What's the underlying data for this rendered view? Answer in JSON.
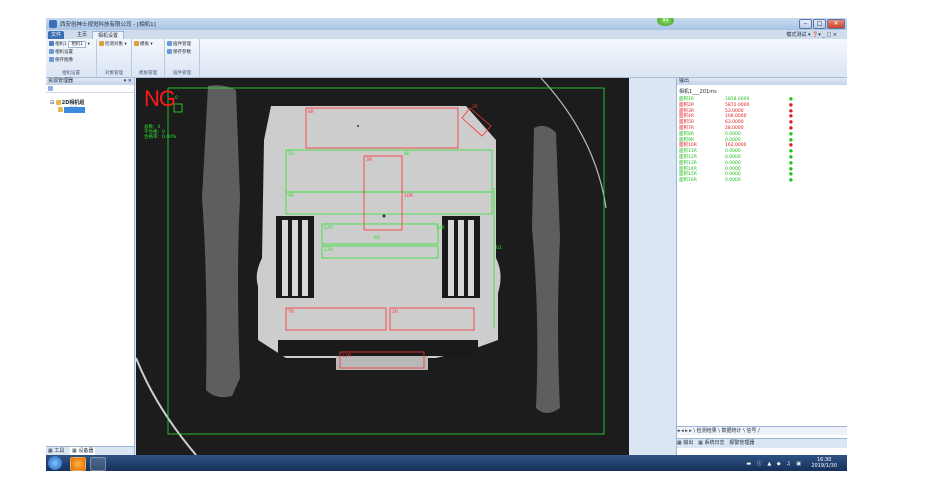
{
  "window": {
    "title": "西安创神士视觉科技有限公司 - [相机1]",
    "ext_badge": "91",
    "minimize": "–",
    "maximize": "□",
    "close": "✕"
  },
  "tabs": {
    "file": "文件",
    "home": "主页",
    "camera_settings": "相机设置"
  },
  "top_right": {
    "mode": "模式测试 ▾",
    "help": "❓▾ _ □ ×"
  },
  "ribbon": {
    "groups": [
      {
        "label": "相机设置",
        "items": [
          "相机1",
          "相机设置",
          "保存图像"
        ],
        "dropdown": "相机1"
      },
      {
        "label": "对象管理",
        "items": [
          "检测对象 ▾"
        ]
      },
      {
        "label": "模板管理",
        "items": [
          "模板 ▾"
        ]
      },
      {
        "label": "插件管理",
        "items": [
          "插件管理",
          "保存参数"
        ]
      }
    ]
  },
  "left_panel": {
    "title": "资源管理器",
    "header_btns": "▾ ✕",
    "tree_root": "2D相机组",
    "tree_child": "相机1",
    "tabs": {
      "tools": "工具",
      "devices": "设备器"
    }
  },
  "viewer": {
    "verdict": "NG",
    "stats": [
      "总数：0",
      "不合格：0",
      "合格率：0.00%"
    ],
    "region_labels": [
      {
        "text": "0",
        "color": "#2fe22f"
      },
      {
        "text": "4R",
        "color": "#ff3030"
      },
      {
        "text": "2R",
        "color": "#ff3030"
      },
      {
        "text": "5R",
        "color": "#2fe22f"
      },
      {
        "text": "8R",
        "color": "#2fe22f"
      },
      {
        "text": "3R",
        "color": "#ff3030"
      },
      {
        "text": "9R",
        "color": "#2fe22f"
      },
      {
        "text": "10R",
        "color": "#ff3030"
      },
      {
        "text": "12R",
        "color": "#2fe22f"
      },
      {
        "text": "13R",
        "color": "#2fe22f"
      },
      {
        "text": "6R",
        "color": "#2fe22f"
      },
      {
        "text": "7R",
        "color": "#ff3030"
      },
      {
        "text": "1R",
        "color": "#ff3030"
      },
      {
        "text": "11R",
        "color": "#ff3030"
      },
      {
        "text": "14R",
        "color": "#2fe22f"
      },
      {
        "text": "01",
        "color": "#2fe22f"
      }
    ]
  },
  "right_panel": {
    "title": "输出",
    "time_line": "相机1___201ms",
    "results": [
      {
        "name": "面积1R",
        "value": "1858.0000",
        "flag": "●",
        "color": "#22c022"
      },
      {
        "name": "面积2R",
        "value": "5872.0000",
        "flag": "●",
        "color": "#e02020"
      },
      {
        "name": "面积3R",
        "value": "53.0000",
        "flag": "●",
        "color": "#e02020"
      },
      {
        "name": "面积4R",
        "value": "106.0000",
        "flag": "●",
        "color": "#e02020"
      },
      {
        "name": "面积5R",
        "value": "63.0000",
        "flag": "●",
        "color": "#e02020"
      },
      {
        "name": "面积7R",
        "value": "28.0000",
        "flag": "●",
        "color": "#e02020"
      },
      {
        "name": "面积8R",
        "value": "0.0000",
        "flag": "●",
        "color": "#22c022"
      },
      {
        "name": "面积9R",
        "value": "0.0000",
        "flag": "●",
        "color": "#22c022"
      },
      {
        "name": "面积10R",
        "value": "162.0000",
        "flag": "●",
        "color": "#e02020"
      },
      {
        "name": "面积11R",
        "value": "0.0000",
        "flag": "●",
        "color": "#22c022"
      },
      {
        "name": "面积12R",
        "value": "0.0000",
        "flag": "●",
        "color": "#22c022"
      },
      {
        "name": "面积13R",
        "value": "0.0000",
        "flag": "●",
        "color": "#22c022"
      },
      {
        "name": "面积14R",
        "value": "0.0000",
        "flag": "●",
        "color": "#22c022"
      },
      {
        "name": "面积15R",
        "value": "0.0000",
        "flag": "●",
        "color": "#22c022"
      },
      {
        "name": "面积16R",
        "value": "0.0000",
        "flag": "●",
        "color": "#22c022"
      }
    ],
    "nav_tabs": "◂ ◂ ▸ ▸ \\ 检测结果 \\ 数据统计 \\ 信号 /",
    "bottom_tabs": [
      "输出",
      "系统日志",
      "报警管理器"
    ]
  },
  "statusbar": {
    "link": "www.hzptsv.com.cn",
    "status": "就绪",
    "project": "项目路径：D:\\CR1\\Project1.hdvsn",
    "detect_time": "检测耗时：2ms",
    "ratio": "ratio = 0.4036",
    "coords": "x:21.34  y:473.24",
    "rgb": "R:10  G:10  B:10",
    "locked": "已停止"
  },
  "taskbar": {
    "time": "16:30",
    "date": "2019/1/30"
  }
}
